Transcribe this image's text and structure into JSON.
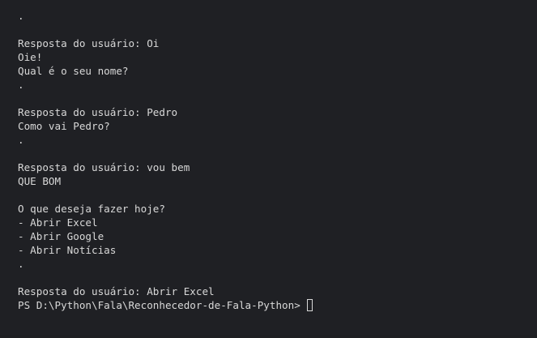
{
  "terminal": {
    "lines": [
      "                                    ",
      ".",
      "",
      "Resposta do usuário: Oi",
      "Oie!",
      "Qual é o seu nome?",
      ".",
      "",
      "Resposta do usuário: Pedro",
      "Como vai Pedro?",
      ".",
      "",
      "Resposta do usuário: vou bem",
      "QUE BOM",
      "",
      "O que deseja fazer hoje?",
      "- Abrir Excel",
      "- Abrir Google",
      "- Abrir Notícias",
      ".",
      "",
      "Resposta do usuário: Abrir Excel"
    ],
    "prompt": "PS D:\\Python\\Fala\\Reconhecedor-de-Fala-Python>"
  }
}
